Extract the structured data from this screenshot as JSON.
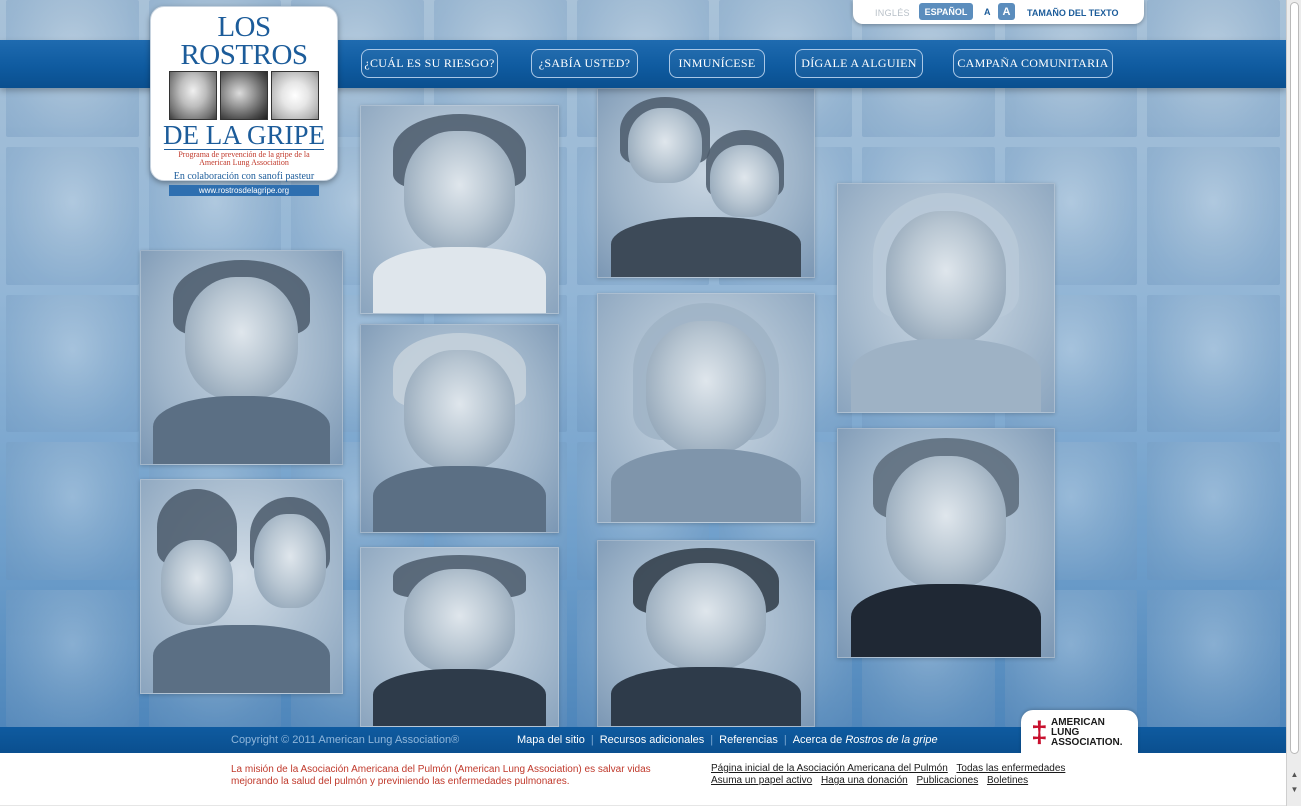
{
  "logo": {
    "title_line1": "LOS ROSTROS",
    "title_line2": "DE LA GRIPE",
    "subtitle": "Programa de prevención de la gripe de la American Lung Association",
    "collaboration": "En colaboración con sanofi pasteur",
    "url": "www.rostrosdelagripe.org"
  },
  "topbar": {
    "lang_ingles": "INGLÉS",
    "lang_espanol": "ESPAÑOL",
    "size_small": "A",
    "size_large": "A",
    "size_label": "TAMAÑO DEL TEXTO"
  },
  "nav": [
    {
      "label": "¿CUÁL ES SU RIESGO?"
    },
    {
      "label": "¿SABÍA USTED?"
    },
    {
      "label": "INMUNÍCESE"
    },
    {
      "label": "DÍGALE A ALGUIEN"
    },
    {
      "label": "CAMPAÑA COMUNITARIA"
    }
  ],
  "footer": {
    "copyright": "Copyright © 2011 American Lung Association®",
    "links": [
      {
        "label": "Mapa del sitio"
      },
      {
        "label": "Recursos adicionales"
      },
      {
        "label": "Referencias"
      }
    ],
    "about_prefix": "Acerca de",
    "about_italic": "Rostros de la gripe",
    "badge_line1": "AMERICAN",
    "badge_line2": "LUNG",
    "badge_line3": "ASSOCIATION.",
    "mission": "La misión de la Asociación Americana del Pulmón (American Lung Association) es salvar vidas mejorando la salud del pulmón y previniendo las enfermedades pulmonares.",
    "bottom_links_row1": [
      "Página inicial de la Asociación Americana del Pulmón",
      "Todas las enfermedades"
    ],
    "bottom_links_row2": [
      "Asuma un papel activo",
      "Haga una donación",
      "Publicaciones",
      "Boletines"
    ]
  }
}
